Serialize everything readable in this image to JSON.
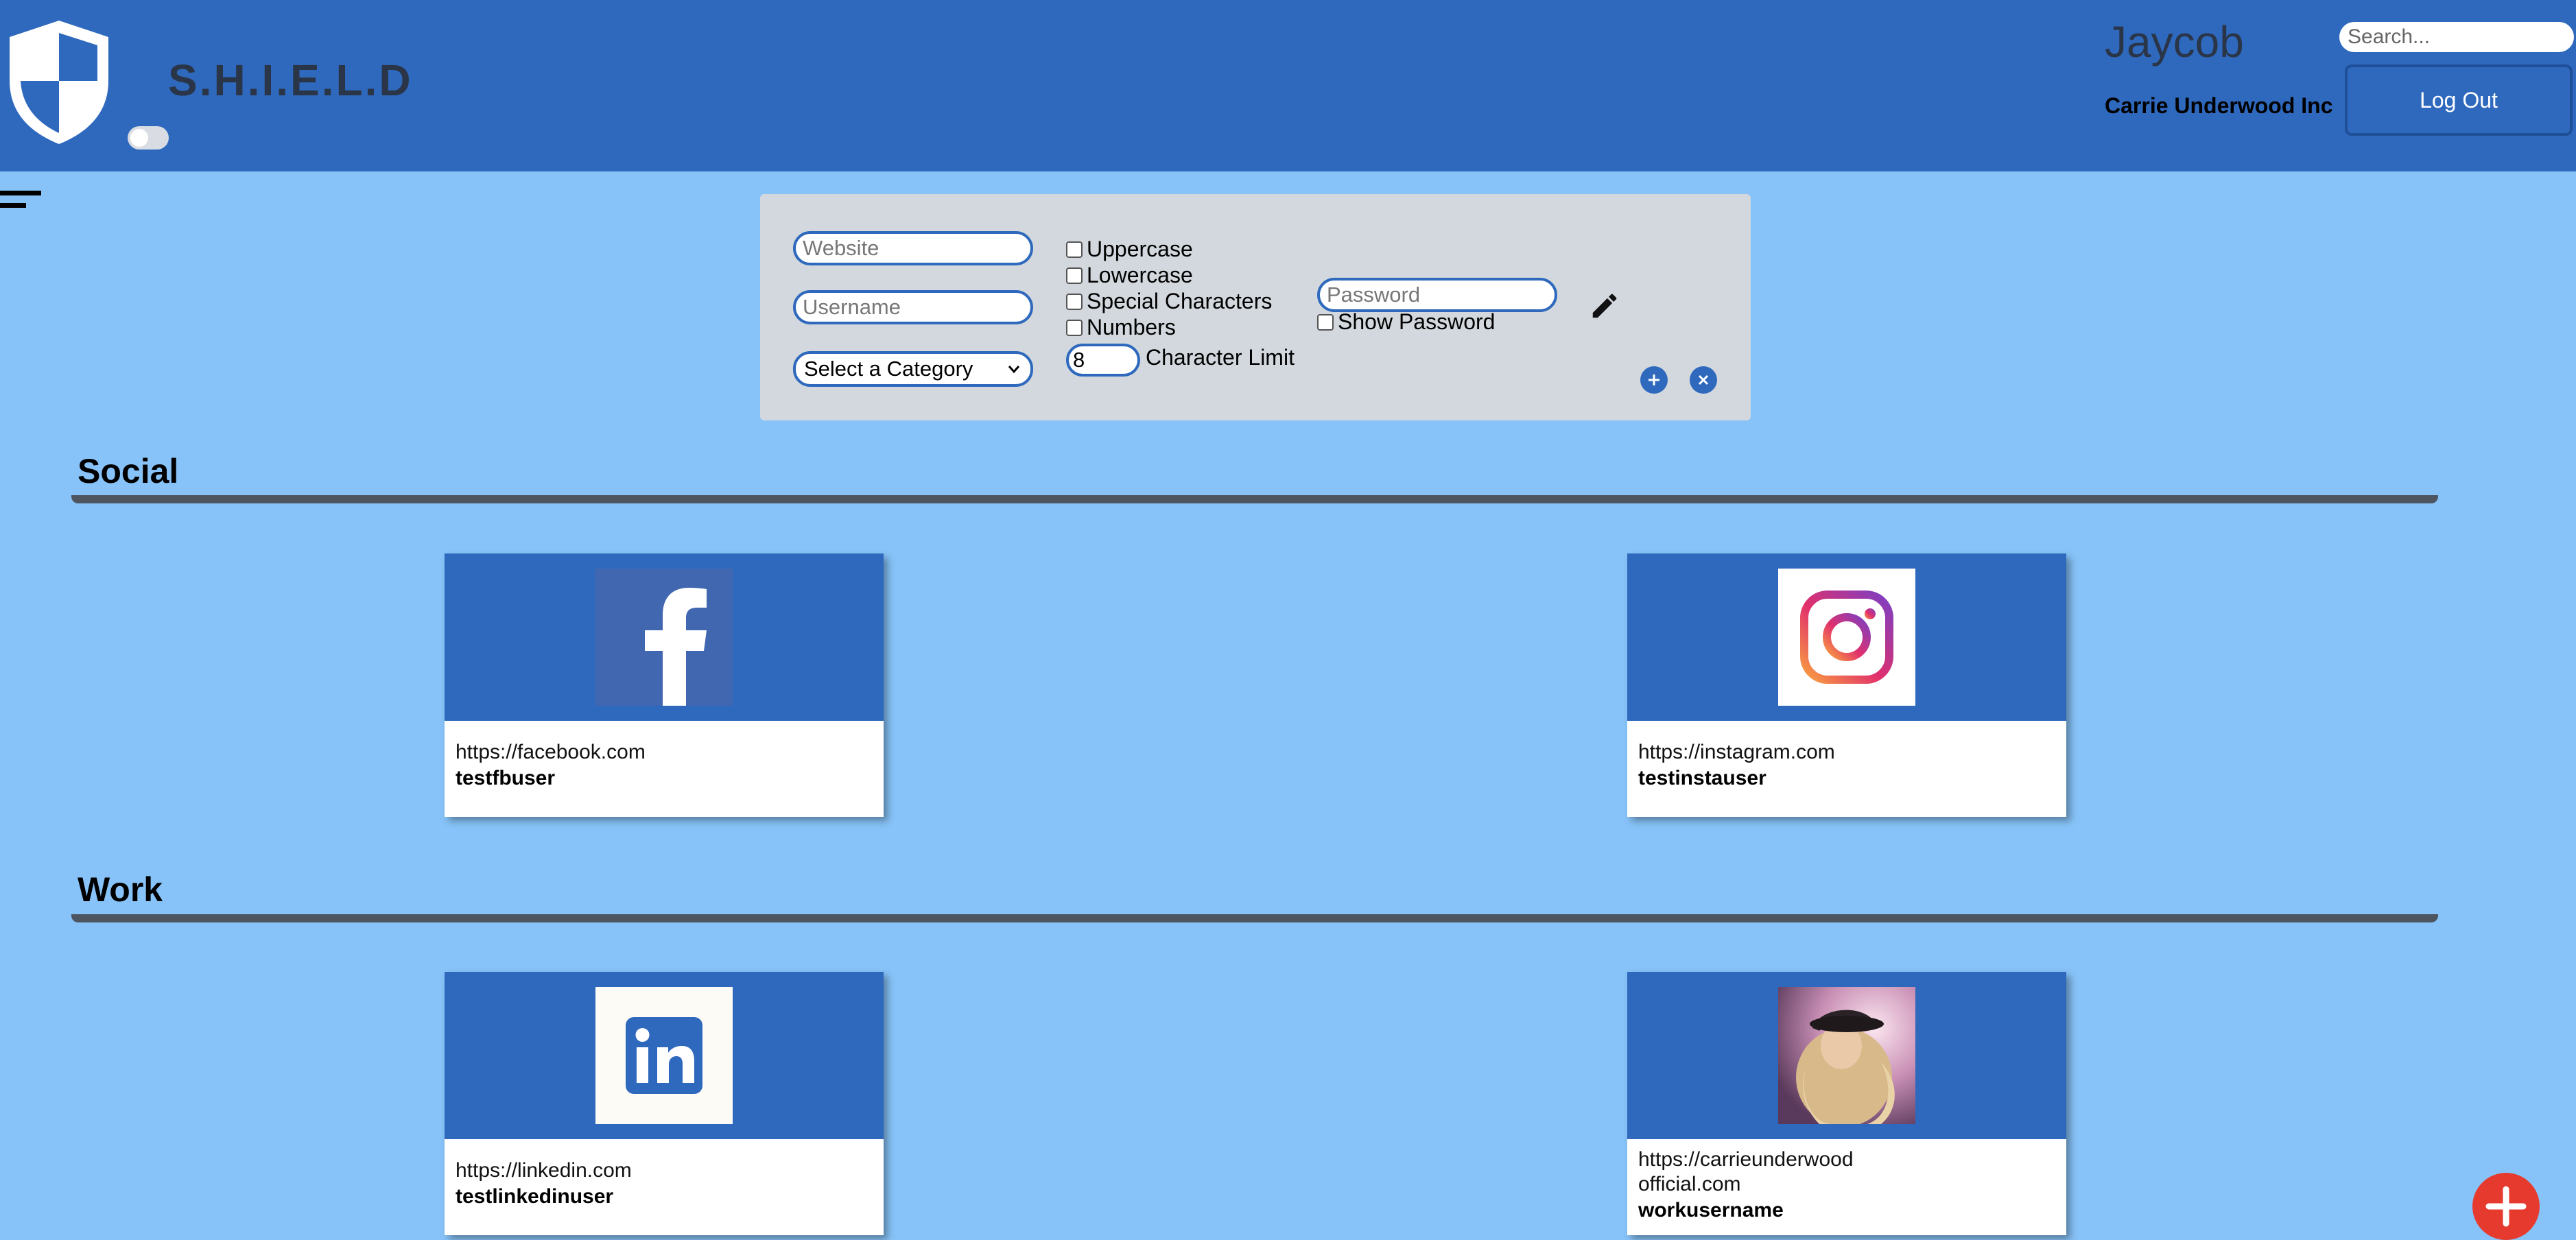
{
  "app": {
    "brand": "S.H.I.E.L.D",
    "colors": {
      "header": "#2f69bd",
      "background": "#87c3f8",
      "panel": "#d2d8dd",
      "fab": "#e73a2e"
    }
  },
  "header": {
    "user_name": "Jaycob",
    "org_name": "Carrie Underwood Inc",
    "search_placeholder": "Search...",
    "logout_label": "Log Out"
  },
  "form": {
    "website_placeholder": "Website",
    "username_placeholder": "Username",
    "category_selected": "Select a Category",
    "options": {
      "uppercase": "Uppercase",
      "lowercase": "Lowercase",
      "special": "Special Characters",
      "numbers": "Numbers"
    },
    "char_limit_value": "8",
    "char_limit_label": "Character Limit",
    "password_placeholder": "Password",
    "show_password_label": "Show Password"
  },
  "categories": [
    {
      "title": "Social",
      "cards": [
        {
          "url": "https://facebook.com",
          "username": "testfbuser",
          "icon": "facebook-logo"
        },
        {
          "url": "https://instagram.com",
          "username": "testinstauser",
          "icon": "instagram-logo"
        }
      ]
    },
    {
      "title": "Work",
      "cards": [
        {
          "url": "https://linkedin.com",
          "username": "testlinkedinuser",
          "icon": "linkedin-logo"
        },
        {
          "url": "https://carrieunderwoodofficial.com",
          "username": "workusername",
          "icon": "portrait-photo"
        }
      ]
    }
  ]
}
